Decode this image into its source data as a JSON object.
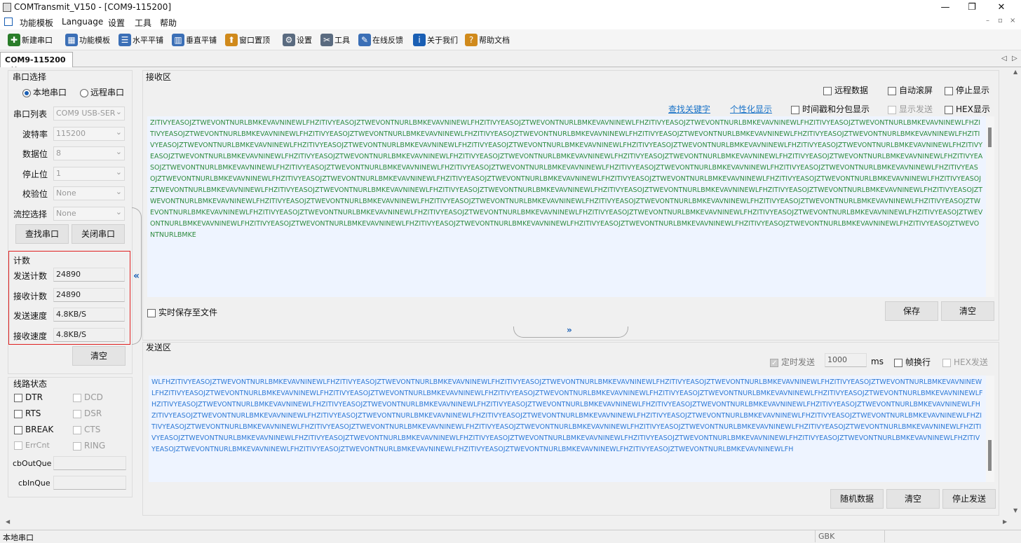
{
  "window": {
    "title": "COMTransmit_V150 - [COM9-115200]"
  },
  "menu": [
    "功能模板",
    "Language",
    "设置",
    "工具",
    "帮助"
  ],
  "toolbar": [
    {
      "label": "新建串口",
      "icon": "new-port-icon",
      "color": "#2a7d2a"
    },
    {
      "label": "功能模板",
      "icon": "template-icon",
      "color": "#3b6fb6"
    },
    {
      "label": "水平平铺",
      "icon": "horizontal-tile-icon",
      "color": "#3b6fb6"
    },
    {
      "label": "垂直平铺",
      "icon": "vertical-tile-icon",
      "color": "#3b6fb6"
    },
    {
      "label": "窗口置顶",
      "icon": "pin-top-icon",
      "color": "#d08a1c"
    },
    {
      "label": "设置",
      "icon": "gear-icon",
      "color": "#5a6b80"
    },
    {
      "label": "工具",
      "icon": "tools-icon",
      "color": "#5a6b80"
    },
    {
      "label": "在线反馈",
      "icon": "feedback-icon",
      "color": "#3b6fb6"
    },
    {
      "label": "关于我们",
      "icon": "info-icon",
      "color": "#1a5fb4"
    },
    {
      "label": "帮助文档",
      "icon": "help-doc-icon",
      "color": "#d08a1c"
    }
  ],
  "tab": {
    "label": "COM9-115200"
  },
  "port": {
    "title": "串口选择",
    "local": "本地串口",
    "remote": "远程串口",
    "fields": [
      {
        "label": "串口列表",
        "value": "COM9   USB-SER"
      },
      {
        "label": "波特率",
        "value": "115200"
      },
      {
        "label": "数据位",
        "value": "8"
      },
      {
        "label": "停止位",
        "value": "1"
      },
      {
        "label": "校验位",
        "value": "None"
      },
      {
        "label": "流控选择",
        "value": "None"
      }
    ],
    "find_btn": "查找串口",
    "close_btn": "关闭串口"
  },
  "count": {
    "title": "计数",
    "rows": [
      {
        "label": "发送计数",
        "value": "24890"
      },
      {
        "label": "接收计数",
        "value": "24890"
      },
      {
        "label": "发送速度",
        "value": "4.8KB/S"
      },
      {
        "label": "接收速度",
        "value": "4.8KB/S"
      }
    ],
    "clear_btn": "清空"
  },
  "line": {
    "title": "线路状态",
    "left": [
      "DTR",
      "RTS",
      "BREAK",
      "ErrCnt"
    ],
    "right": [
      "DCD",
      "DSR",
      "CTS",
      "RING"
    ],
    "cbOutQue": "cbOutQue",
    "cbInQue": "cbInQue"
  },
  "recv": {
    "title": "接收区",
    "opt_remote": "远程数据",
    "opt_autoscroll": "自动滚屏",
    "opt_stop": "停止显示",
    "link_find": "查找关键字",
    "link_custom": "个性化显示",
    "opt_timestamp": "时间戳和分包显示",
    "opt_showsend": "显示发送",
    "opt_hex": "HEX显示",
    "text": "ZITIVYEASOJZTWEVONTNURLBMKEVAVNINEWLFHZITIVYEASOJZTWEVONTNURLBMKEVAVNINEWLFHZITIVYEASOJZTWEVONTNURLBMKEVAVNINEWLFHZITIVYEASOJZTWEVONTNURLBMKEVAVNINEWLFHZITIVYEASOJZTWEVONTNURLBMKEVAVNINEWLFHZITIVYEASOJZTWEVONTNURLBMKEVAVNINEWLFHZITIVYEASOJZTWEVONTNURLBMKEVAVNINEWLFHZITIVYEASOJZTWEVONTNURLBMKEVAVNINEWLFHZITIVYEASOJZTWEVONTNURLBMKEVAVNINEWLFHZITIVYEASOJZTWEVONTNURLBMKEVAVNINEWLFHZITIVYEASOJZTWEVONTNURLBMKEVAVNINEWLFHZITIVYEASOJZTWEVONTNURLBMKEVAVNINEWLFHZITIVYEASOJZTWEVONTNURLBMKEVAVNINEWLFHZITIVYEASOJZTWEVONTNURLBMKEVAVNINEWLFHZITIVYEASOJZTWEVONTNURLBMKEVAVNINEWLFHZITIVYEASOJZTWEVONTNURLBMKEVAVNINEWLFHZITIVYEASOJZTWEVONTNURLBMKEVAVNINEWLFHZITIVYEASOJZTWEVONTNURLBMKEVAVNINEWLFHZITIVYEASOJZTWEVONTNURLBMKEVAVNINEWLFHZITIVYEASOJZTWEVONTNURLBMKEVAVNINEWLFHZITIVYEASOJZTWEVONTNURLBMKEVAVNINEWLFHZITIVYEASOJZTWEVONTNURLBMKEVAVNINEWLFHZITIVYEASOJZTWEVONTNURLBMKEVAVNINEWLFHZITIVYEASOJZTWEVONTNURLBMKEVAVNINEWLFHZITIVYEASOJZTWEVONTNURLBMKEVAVNINEWLFHZITIVYEASOJZTWEVONTNURLBMKEVAVNINEWLFHZITIVYEASOJZTWEVONTNURLBMKEVAVNINEWLFHZITIVYEASOJZTWEVONTNURLBMKEVAVNINEWLFHZITIVYEASOJZTWEVONTNURLBMKEVAVNINEWLFHZITIVYEASOJZTWEVONTNURLBMKEVAVNINEWLFHZITIVYEASOJZTWEVONTNURLBMKEVAVNINEWLFHZITIVYEASOJZTWEVONTNURLBMKEVAVNINEWLFHZITIVYEASOJZTWEVONTNURLBMKEVAVNINEWLFHZITIVYEASOJZTWEVONTNURLBMKEVAVNINEWLFHZITIVYEASOJZTWEVONTNURLBMKEVAVNINEWLFHZITIVYEASOJZTWEVONTNURLBMKEVAVNINEWLFHZITIVYEASOJZTWEVONTNURLBMKEVAVNINEWLFHZITIVYEASOJZTWEVONTNURLBMKEVAVNINEWLFHZITIVYEASOJZTWEVONTNURLBMKEVAVNINEWLFHZITIVYEASOJZTWEVONTNURLBMKEVAVNINEWLFHZITIVYEASOJZTWEVONTNURLBMKEVAVNINEWLFHZITIVYEASOJZTWEVONTNURLBMKEVAVNINEWLFHZITIVYEASOJZTWEVONTNURLBMKEVAVNINEWLFHZITIVYEASOJZTWEVONTNURLBMKEVAVNINEWLFHZITIVYEASOJZTWEVONTNURLBMKEVAVNINEWLFHZITIVYEASOJZTWEVONTNURLBMKEVAVNINEWLFHZITIVYEASOJZTWEVONTNURLBMKEVAVNINEWLFHZITIVYEASOJZTWEVONTNURLBMKEVAVNINEWLFHZITIVYEASOJZTWEVONTNURLBMKEVAVNINEWLFHZITIVYEASOJZTWEVONTNURLBMKEVAVNINEWLFHZITIVYEASOJZTWEVONTNURLBMKE",
    "save_realtime": "实时保存至文件",
    "save_btn": "保存",
    "clear_btn": "清空"
  },
  "send": {
    "title": "发送区",
    "opt_timer": "定时发送",
    "interval": "1000",
    "unit": "ms",
    "opt_newline": "帧换行",
    "opt_hex": "HEX发送",
    "text": "WLFHZITIVYEASOJZTWEVONTNURLBMKEVAVNINEWLFHZITIVYEASOJZTWEVONTNURLBMKEVAVNINEWLFHZITIVYEASOJZTWEVONTNURLBMKEVAVNINEWLFHZITIVYEASOJZTWEVONTNURLBMKEVAVNINEWLFHZITIVYEASOJZTWEVONTNURLBMKEVAVNINEWLFHZITIVYEASOJZTWEVONTNURLBMKEVAVNINEWLFHZITIVYEASOJZTWEVONTNURLBMKEVAVNINEWLFHZITIVYEASOJZTWEVONTNURLBMKEVAVNINEWLFHZITIVYEASOJZTWEVONTNURLBMKEVAVNINEWLFHZITIVYEASOJZTWEVONTNURLBMKEVAVNINEWLFHZITIVYEASOJZTWEVONTNURLBMKEVAVNINEWLFHZITIVYEASOJZTWEVONTNURLBMKEVAVNINEWLFHZITIVYEASOJZTWEVONTNURLBMKEVAVNINEWLFHZITIVYEASOJZTWEVONTNURLBMKEVAVNINEWLFHZITIVYEASOJZTWEVONTNURLBMKEVAVNINEWLFHZITIVYEASOJZTWEVONTNURLBMKEVAVNINEWLFHZITIVYEASOJZTWEVONTNURLBMKEVAVNINEWLFHZITIVYEASOJZTWEVONTNURLBMKEVAVNINEWLFHZITIVYEASOJZTWEVONTNURLBMKEVAVNINEWLFHZITIVYEASOJZTWEVONTNURLBMKEVAVNINEWLFHZITIVYEASOJZTWEVONTNURLBMKEVAVNINEWLFHZITIVYEASOJZTWEVONTNURLBMKEVAVNINEWLFHZITIVYEASOJZTWEVONTNURLBMKEVAVNINEWLFHZITIVYEASOJZTWEVONTNURLBMKEVAVNINEWLFHZITIVYEASOJZTWEVONTNURLBMKEVAVNINEWLFHZITIVYEASOJZTWEVONTNURLBMKEVAVNINEWLFHZITIVYEASOJZTWEVONTNURLBMKEVAVNINEWLFHZITIVYEASOJZTWEVONTNURLBMKEVAVNINEWLFHZITIVYEASOJZTWEVONTNURLBMKEVAVNINEWLFHZITIVYEASOJZTWEVONTNURLBMKEVAVNINEWLFHZITIVYEASOJZTWEVONTNURLBMKEVAVNINEWLFHZITIVYEASOJZTWEVONTNURLBMKEVAVNINEWLFHZITIVYEASOJZTWEVONTNURLBMKEVAVNINEWLFHZITIVYEASOJZTWEVONTNURLBMKEVAVNINEWLFH",
    "random_btn": "随机数据",
    "clear_btn": "清空",
    "stop_btn": "停止发送"
  },
  "status": {
    "left": "本地串口",
    "encoding": "GBK"
  },
  "colors": {
    "recv_text": "#2e8b3e",
    "send_text": "#2f7ad6",
    "highlight": "#e02020",
    "text_bg": "#eef4ff"
  }
}
